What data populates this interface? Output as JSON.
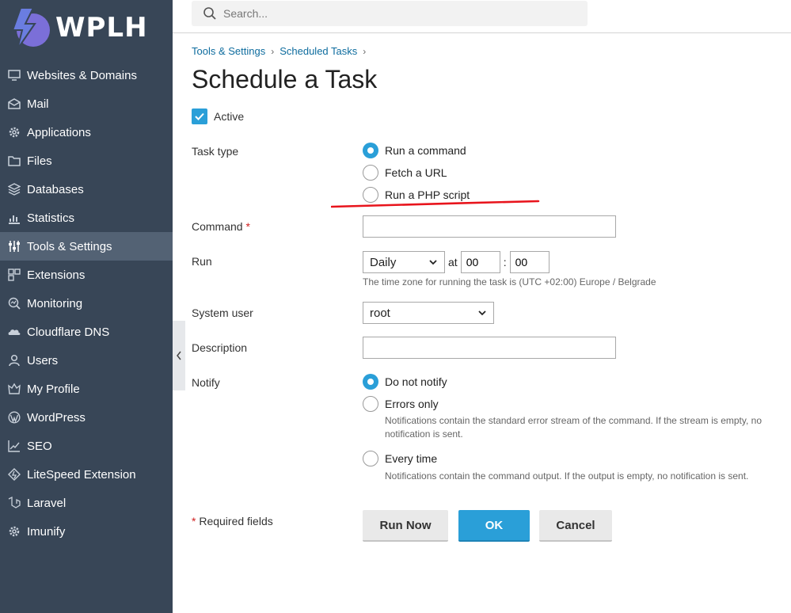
{
  "brand": {
    "logo_text": "WPLH"
  },
  "sidebar": {
    "items": [
      {
        "label": "Websites & Domains",
        "icon": "monitor-icon"
      },
      {
        "label": "Mail",
        "icon": "mail-icon"
      },
      {
        "label": "Applications",
        "icon": "gear-icon"
      },
      {
        "label": "Files",
        "icon": "folder-icon"
      },
      {
        "label": "Databases",
        "icon": "database-icon"
      },
      {
        "label": "Statistics",
        "icon": "bar-chart-icon"
      },
      {
        "label": "Tools & Settings",
        "icon": "sliders-icon",
        "active": true
      },
      {
        "label": "Extensions",
        "icon": "extensions-icon"
      },
      {
        "label": "Monitoring",
        "icon": "monitoring-icon"
      },
      {
        "label": "Cloudflare DNS",
        "icon": "cloud-icon"
      },
      {
        "label": "Users",
        "icon": "user-icon"
      },
      {
        "label": "My Profile",
        "icon": "profile-icon"
      },
      {
        "label": "WordPress",
        "icon": "wordpress-icon"
      },
      {
        "label": "SEO",
        "icon": "seo-chart-icon"
      },
      {
        "label": "LiteSpeed Extension",
        "icon": "litespeed-icon"
      },
      {
        "label": "Laravel",
        "icon": "laravel-icon"
      },
      {
        "label": "Imunify",
        "icon": "imunify-gear-icon"
      }
    ]
  },
  "search": {
    "placeholder": "Search..."
  },
  "breadcrumb": {
    "items": [
      "Tools & Settings",
      "Scheduled Tasks"
    ]
  },
  "page": {
    "title": "Schedule a Task"
  },
  "form": {
    "active_label": "Active",
    "active_checked": true,
    "task_type": {
      "label": "Task type",
      "options": [
        "Run a command",
        "Fetch a URL",
        "Run a PHP script"
      ],
      "selected": "Run a command"
    },
    "command": {
      "label": "Command",
      "required_mark": "*",
      "value": ""
    },
    "run": {
      "label": "Run",
      "frequency": "Daily",
      "at_label": "at",
      "hour": "00",
      "colon": ":",
      "minute": "00",
      "timezone_hint": "The time zone for running the task is (UTC +02:00) Europe / Belgrade"
    },
    "system_user": {
      "label": "System user",
      "value": "root"
    },
    "description": {
      "label": "Description",
      "value": ""
    },
    "notify": {
      "label": "Notify",
      "options": [
        {
          "label": "Do not notify",
          "hint": ""
        },
        {
          "label": "Errors only",
          "hint": "Notifications contain the standard error stream of the command. If the stream is empty, no notification is sent."
        },
        {
          "label": "Every time",
          "hint": "Notifications contain the command output. If the output is empty, no notification is sent."
        }
      ],
      "selected": "Do not notify"
    },
    "required_note": {
      "mark": "*",
      "text": " Required fields"
    }
  },
  "buttons": {
    "run_now": "Run Now",
    "ok": "OK",
    "cancel": "Cancel"
  },
  "colors": {
    "sidebar_bg": "#384657",
    "sidebar_active": "#536274",
    "accent": "#2a9fd8",
    "link": "#0e6c9e",
    "annotation": "#e8141c"
  }
}
